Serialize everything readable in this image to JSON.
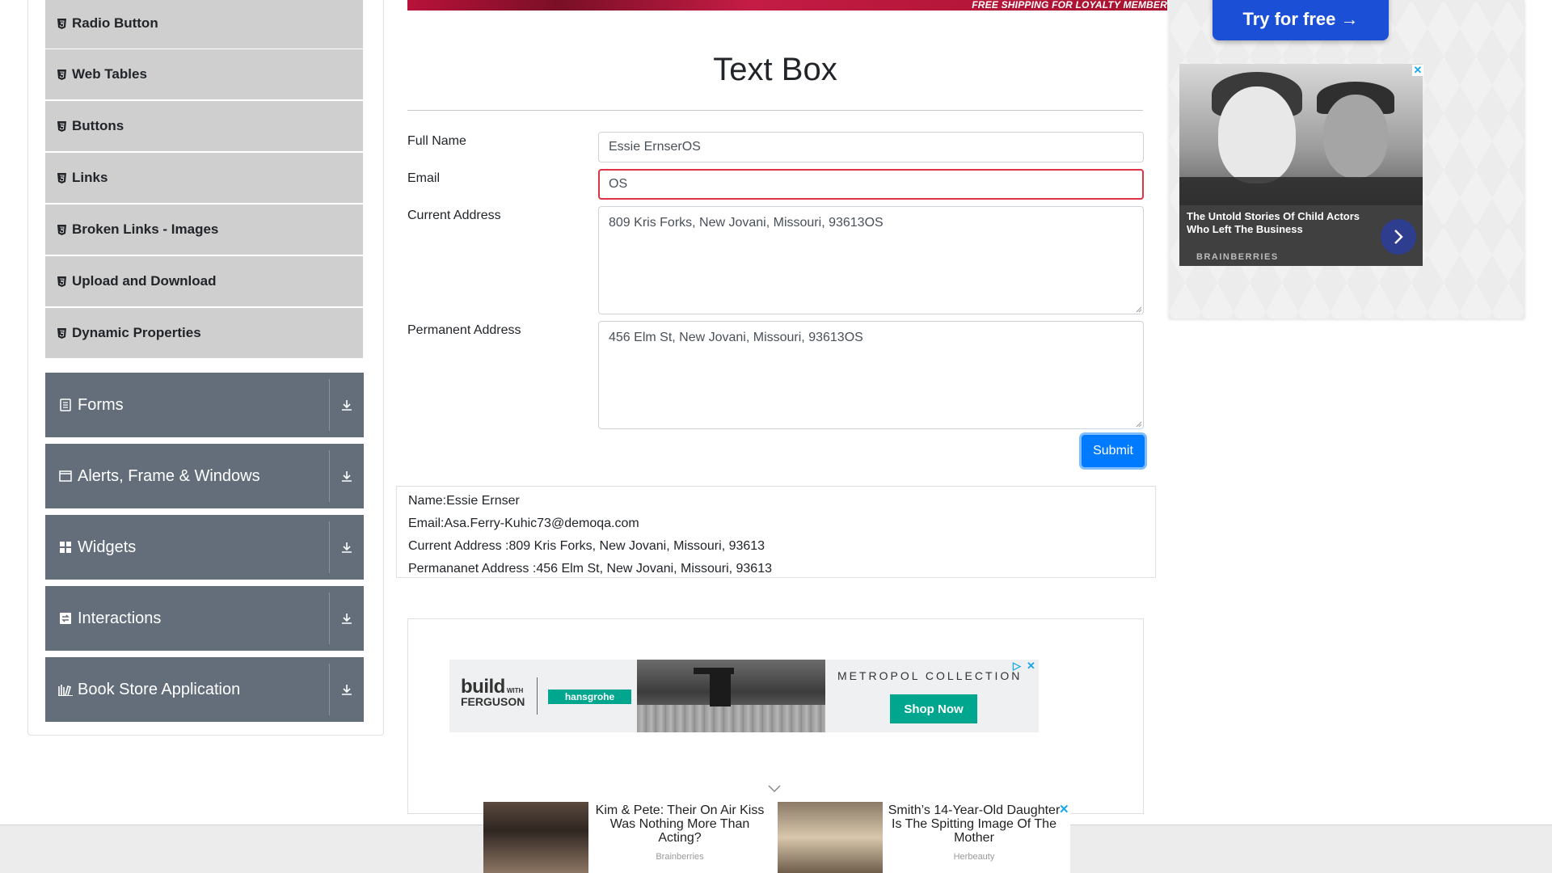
{
  "sidebar": {
    "elements_items": [
      {
        "label": "Radio Button"
      },
      {
        "label": "Web Tables"
      },
      {
        "label": "Buttons"
      },
      {
        "label": "Links"
      },
      {
        "label": "Broken Links - Images"
      },
      {
        "label": "Upload and Download"
      },
      {
        "label": "Dynamic Properties"
      }
    ],
    "groups": [
      {
        "label": "Forms",
        "icon": "form-icon"
      },
      {
        "label": "Alerts, Frame & Windows",
        "icon": "window-icon"
      },
      {
        "label": "Widgets",
        "icon": "widgets-icon"
      },
      {
        "label": "Interactions",
        "icon": "interactions-icon"
      },
      {
        "label": "Book Store Application",
        "icon": "book-store-icon"
      }
    ]
  },
  "top_banner": {
    "text": "FREE SHIPPING FOR LOYALTY MEMBER"
  },
  "main": {
    "title": "Text Box",
    "form": {
      "full_name_label": "Full Name",
      "full_name_value": "Essie ErnserOS",
      "email_label": "Email",
      "email_value": "OS",
      "current_address_label": "Current Address",
      "current_address_value": "809 Kris Forks, New Jovani, Missouri, 93613OS",
      "permanent_address_label": "Permanent Address",
      "permanent_address_value": "456 Elm St, New Jovani, Missouri, 93613OS",
      "submit_label": "Submit"
    },
    "output": {
      "name": "Name:Essie Ernser",
      "email": "Email:Asa.Ferry-Kuhic73@demoqa.com",
      "current_address": "Current Address :809 Kris Forks, New Jovani, Missouri, 93613",
      "permanent_address": "Permananet Address :456 Elm St, New Jovani, Missouri, 93613"
    }
  },
  "ad_banner": {
    "logo_line1": "build",
    "logo_line2": "FERGUSON",
    "logo_with": "WITH",
    "brand": "hansgrohe",
    "collection": "METROPOL COLLECTION",
    "cta": "Shop Now"
  },
  "right_ad": {
    "cta": "Try for free →",
    "title": "The Untold Stories Of Child Actors Who Left The Business",
    "brand": "BRAINBERRIES",
    "close": "✕"
  },
  "bottom_ad": {
    "item1_text": "Kim & Pete: Their On Air Kiss Was Nothing More Than Acting?",
    "item1_source": "Brainberries",
    "item2_text": "Smith’s 14-Year-Old Daughter Is The Spitting Image Of The Mother",
    "item2_source": "Herbeauty",
    "close": "✕"
  },
  "colors": {
    "accordion_bg": "#646e7a",
    "submenu_bg": "#cfcfcf",
    "primary": "#007bff",
    "invalid": "#dc3545"
  }
}
